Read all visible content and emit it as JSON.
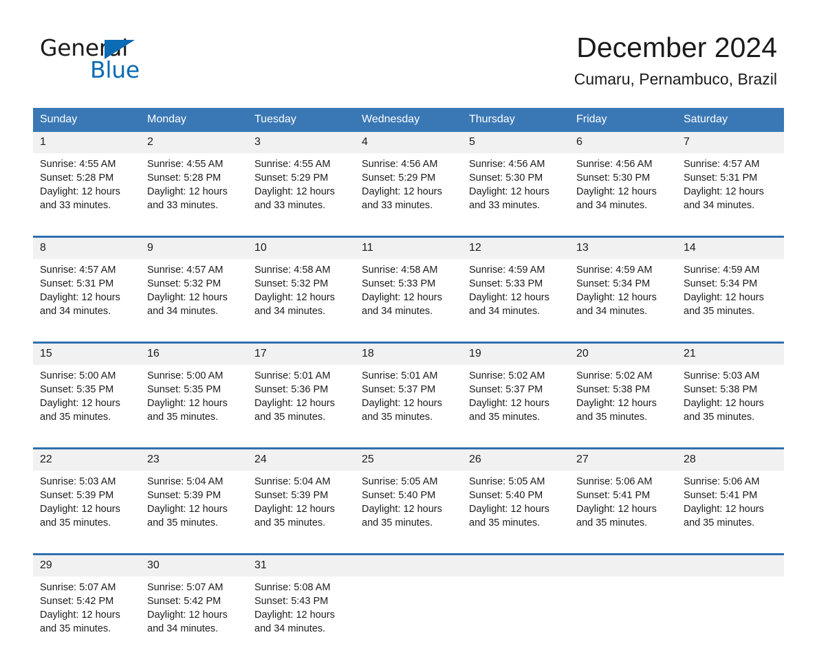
{
  "brand": {
    "name_part1": "General",
    "name_part2": "Blue",
    "logo_icon": "triangle-logo-icon",
    "accent_color": "#0b6bb5"
  },
  "header": {
    "month_title": "December 2024",
    "location": "Cumaru, Pernambuco, Brazil"
  },
  "theme": {
    "header_row_bg": "#3a78b5",
    "row_divider": "#2f6fae",
    "daynum_bg": "#f1f1f1",
    "text": "#1b1b1b"
  },
  "calendar": {
    "weekday_headers": [
      "Sunday",
      "Monday",
      "Tuesday",
      "Wednesday",
      "Thursday",
      "Friday",
      "Saturday"
    ],
    "weeks": [
      [
        {
          "day": "1",
          "sunrise": "Sunrise: 4:55 AM",
          "sunset": "Sunset: 5:28 PM",
          "daylight_line1": "Daylight: 12 hours",
          "daylight_line2": "and 33 minutes."
        },
        {
          "day": "2",
          "sunrise": "Sunrise: 4:55 AM",
          "sunset": "Sunset: 5:28 PM",
          "daylight_line1": "Daylight: 12 hours",
          "daylight_line2": "and 33 minutes."
        },
        {
          "day": "3",
          "sunrise": "Sunrise: 4:55 AM",
          "sunset": "Sunset: 5:29 PM",
          "daylight_line1": "Daylight: 12 hours",
          "daylight_line2": "and 33 minutes."
        },
        {
          "day": "4",
          "sunrise": "Sunrise: 4:56 AM",
          "sunset": "Sunset: 5:29 PM",
          "daylight_line1": "Daylight: 12 hours",
          "daylight_line2": "and 33 minutes."
        },
        {
          "day": "5",
          "sunrise": "Sunrise: 4:56 AM",
          "sunset": "Sunset: 5:30 PM",
          "daylight_line1": "Daylight: 12 hours",
          "daylight_line2": "and 33 minutes."
        },
        {
          "day": "6",
          "sunrise": "Sunrise: 4:56 AM",
          "sunset": "Sunset: 5:30 PM",
          "daylight_line1": "Daylight: 12 hours",
          "daylight_line2": "and 34 minutes."
        },
        {
          "day": "7",
          "sunrise": "Sunrise: 4:57 AM",
          "sunset": "Sunset: 5:31 PM",
          "daylight_line1": "Daylight: 12 hours",
          "daylight_line2": "and 34 minutes."
        }
      ],
      [
        {
          "day": "8",
          "sunrise": "Sunrise: 4:57 AM",
          "sunset": "Sunset: 5:31 PM",
          "daylight_line1": "Daylight: 12 hours",
          "daylight_line2": "and 34 minutes."
        },
        {
          "day": "9",
          "sunrise": "Sunrise: 4:57 AM",
          "sunset": "Sunset: 5:32 PM",
          "daylight_line1": "Daylight: 12 hours",
          "daylight_line2": "and 34 minutes."
        },
        {
          "day": "10",
          "sunrise": "Sunrise: 4:58 AM",
          "sunset": "Sunset: 5:32 PM",
          "daylight_line1": "Daylight: 12 hours",
          "daylight_line2": "and 34 minutes."
        },
        {
          "day": "11",
          "sunrise": "Sunrise: 4:58 AM",
          "sunset": "Sunset: 5:33 PM",
          "daylight_line1": "Daylight: 12 hours",
          "daylight_line2": "and 34 minutes."
        },
        {
          "day": "12",
          "sunrise": "Sunrise: 4:59 AM",
          "sunset": "Sunset: 5:33 PM",
          "daylight_line1": "Daylight: 12 hours",
          "daylight_line2": "and 34 minutes."
        },
        {
          "day": "13",
          "sunrise": "Sunrise: 4:59 AM",
          "sunset": "Sunset: 5:34 PM",
          "daylight_line1": "Daylight: 12 hours",
          "daylight_line2": "and 34 minutes."
        },
        {
          "day": "14",
          "sunrise": "Sunrise: 4:59 AM",
          "sunset": "Sunset: 5:34 PM",
          "daylight_line1": "Daylight: 12 hours",
          "daylight_line2": "and 35 minutes."
        }
      ],
      [
        {
          "day": "15",
          "sunrise": "Sunrise: 5:00 AM",
          "sunset": "Sunset: 5:35 PM",
          "daylight_line1": "Daylight: 12 hours",
          "daylight_line2": "and 35 minutes."
        },
        {
          "day": "16",
          "sunrise": "Sunrise: 5:00 AM",
          "sunset": "Sunset: 5:35 PM",
          "daylight_line1": "Daylight: 12 hours",
          "daylight_line2": "and 35 minutes."
        },
        {
          "day": "17",
          "sunrise": "Sunrise: 5:01 AM",
          "sunset": "Sunset: 5:36 PM",
          "daylight_line1": "Daylight: 12 hours",
          "daylight_line2": "and 35 minutes."
        },
        {
          "day": "18",
          "sunrise": "Sunrise: 5:01 AM",
          "sunset": "Sunset: 5:37 PM",
          "daylight_line1": "Daylight: 12 hours",
          "daylight_line2": "and 35 minutes."
        },
        {
          "day": "19",
          "sunrise": "Sunrise: 5:02 AM",
          "sunset": "Sunset: 5:37 PM",
          "daylight_line1": "Daylight: 12 hours",
          "daylight_line2": "and 35 minutes."
        },
        {
          "day": "20",
          "sunrise": "Sunrise: 5:02 AM",
          "sunset": "Sunset: 5:38 PM",
          "daylight_line1": "Daylight: 12 hours",
          "daylight_line2": "and 35 minutes."
        },
        {
          "day": "21",
          "sunrise": "Sunrise: 5:03 AM",
          "sunset": "Sunset: 5:38 PM",
          "daylight_line1": "Daylight: 12 hours",
          "daylight_line2": "and 35 minutes."
        }
      ],
      [
        {
          "day": "22",
          "sunrise": "Sunrise: 5:03 AM",
          "sunset": "Sunset: 5:39 PM",
          "daylight_line1": "Daylight: 12 hours",
          "daylight_line2": "and 35 minutes."
        },
        {
          "day": "23",
          "sunrise": "Sunrise: 5:04 AM",
          "sunset": "Sunset: 5:39 PM",
          "daylight_line1": "Daylight: 12 hours",
          "daylight_line2": "and 35 minutes."
        },
        {
          "day": "24",
          "sunrise": "Sunrise: 5:04 AM",
          "sunset": "Sunset: 5:39 PM",
          "daylight_line1": "Daylight: 12 hours",
          "daylight_line2": "and 35 minutes."
        },
        {
          "day": "25",
          "sunrise": "Sunrise: 5:05 AM",
          "sunset": "Sunset: 5:40 PM",
          "daylight_line1": "Daylight: 12 hours",
          "daylight_line2": "and 35 minutes."
        },
        {
          "day": "26",
          "sunrise": "Sunrise: 5:05 AM",
          "sunset": "Sunset: 5:40 PM",
          "daylight_line1": "Daylight: 12 hours",
          "daylight_line2": "and 35 minutes."
        },
        {
          "day": "27",
          "sunrise": "Sunrise: 5:06 AM",
          "sunset": "Sunset: 5:41 PM",
          "daylight_line1": "Daylight: 12 hours",
          "daylight_line2": "and 35 minutes."
        },
        {
          "day": "28",
          "sunrise": "Sunrise: 5:06 AM",
          "sunset": "Sunset: 5:41 PM",
          "daylight_line1": "Daylight: 12 hours",
          "daylight_line2": "and 35 minutes."
        }
      ],
      [
        {
          "day": "29",
          "sunrise": "Sunrise: 5:07 AM",
          "sunset": "Sunset: 5:42 PM",
          "daylight_line1": "Daylight: 12 hours",
          "daylight_line2": "and 35 minutes."
        },
        {
          "day": "30",
          "sunrise": "Sunrise: 5:07 AM",
          "sunset": "Sunset: 5:42 PM",
          "daylight_line1": "Daylight: 12 hours",
          "daylight_line2": "and 34 minutes."
        },
        {
          "day": "31",
          "sunrise": "Sunrise: 5:08 AM",
          "sunset": "Sunset: 5:43 PM",
          "daylight_line1": "Daylight: 12 hours",
          "daylight_line2": "and 34 minutes."
        },
        {
          "day": "",
          "sunrise": "",
          "sunset": "",
          "daylight_line1": "",
          "daylight_line2": ""
        },
        {
          "day": "",
          "sunrise": "",
          "sunset": "",
          "daylight_line1": "",
          "daylight_line2": ""
        },
        {
          "day": "",
          "sunrise": "",
          "sunset": "",
          "daylight_line1": "",
          "daylight_line2": ""
        },
        {
          "day": "",
          "sunrise": "",
          "sunset": "",
          "daylight_line1": "",
          "daylight_line2": ""
        }
      ]
    ]
  }
}
